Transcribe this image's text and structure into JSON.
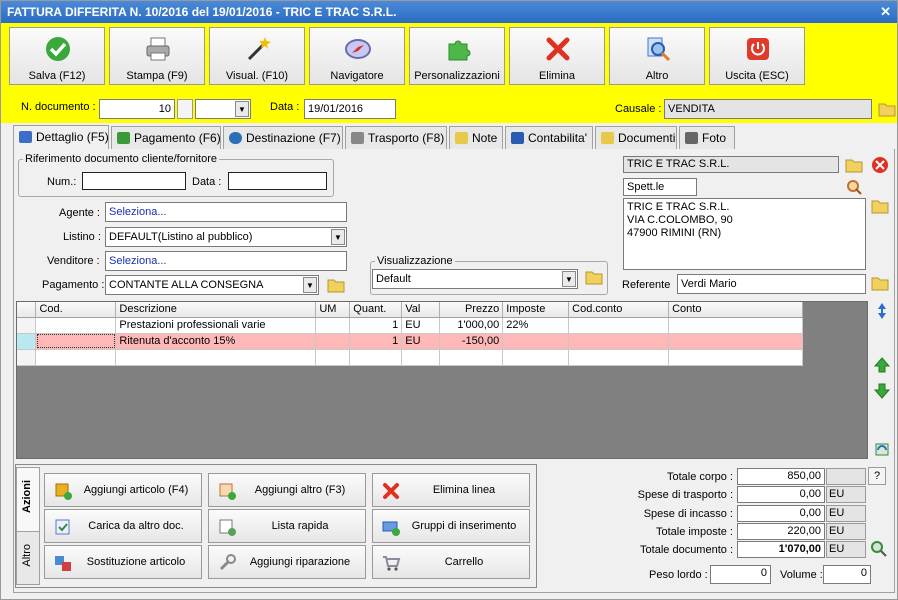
{
  "window": {
    "title": "FATTURA DIFFERITA N. 10/2016 del 19/01/2016 - TRIC E TRAC S.R.L."
  },
  "toolbar": [
    {
      "label": "Salva (F12)",
      "icon": "check-icon",
      "color": "#3aa83a"
    },
    {
      "label": "Stampa (F9)",
      "icon": "printer-icon",
      "color": "#888888"
    },
    {
      "label": "Visual. (F10)",
      "icon": "magic-wand-icon",
      "color": "#333333"
    },
    {
      "label": "Navigatore",
      "icon": "compass-icon",
      "color": "#6a6ab0"
    },
    {
      "label": "Personalizzazioni",
      "icon": "puzzle-icon",
      "color": "#4cb848"
    },
    {
      "label": "Elimina",
      "icon": "red-x-icon",
      "color": "#e03020"
    },
    {
      "label": "Altro",
      "icon": "magnifier-icon",
      "color": "#3a7ad0"
    },
    {
      "label": "Uscita (ESC)",
      "icon": "power-icon",
      "color": "#e03a2a"
    }
  ],
  "header": {
    "ndoc_label": "N. documento :",
    "ndoc_value": "10",
    "data_label": "Data :",
    "data_value": "19/01/2016",
    "causale_label": "Causale :",
    "causale_value": "VENDITA"
  },
  "tabs": [
    {
      "label": "Dettaglio (F5)",
      "icon": "detail-icon",
      "color": "#3a6ec8"
    },
    {
      "label": "Pagamento (F6)",
      "icon": "payment-icon",
      "color": "#3a9a3a"
    },
    {
      "label": "Destinazione (F7)",
      "icon": "globe-icon",
      "color": "#2a70b8"
    },
    {
      "label": "Trasporto (F8)",
      "icon": "truck-icon",
      "color": "#888888"
    },
    {
      "label": "Note",
      "icon": "note-icon",
      "color": "#e8c84a"
    },
    {
      "label": "Contabilita'",
      "icon": "book-icon",
      "color": "#2a5ab0"
    },
    {
      "label": "Documenti",
      "icon": "folder-icon",
      "color": "#e8c84a"
    },
    {
      "label": "Foto",
      "icon": "camera-icon",
      "color": "#666666"
    }
  ],
  "riferimento": {
    "legend": "Riferimento documento cliente/fornitore",
    "num_label": "Num.:",
    "data_label": "Data :",
    "num_value": "",
    "data_value": ""
  },
  "form": {
    "agente_label": "Agente :",
    "agente_value": "Seleziona...",
    "listino_label": "Listino :",
    "listino_value": "DEFAULT(Listino al pubblico)",
    "venditore_label": "Venditore :",
    "venditore_value": "Seleziona...",
    "pagamento_label": "Pagamento :",
    "pagamento_value": "CONTANTE ALLA CONSEGNA"
  },
  "visualizzazione": {
    "legend": "Visualizzazione",
    "value": "Default"
  },
  "cliente": {
    "name": "TRIC E TRAC S.R.L.",
    "salutation": "Spett.le",
    "address": [
      "TRIC E TRAC S.R.L.",
      "VIA C.COLOMBO, 90",
      "47900 RIMINI (RN)"
    ],
    "referente_label": "Referente",
    "referente_value": "Verdi Mario"
  },
  "grid": {
    "columns": [
      "Cod.",
      "Descrizione",
      "UM",
      "Quant.",
      "Val",
      "Prezzo",
      "Imposte",
      "Cod.conto",
      "Conto"
    ],
    "rows": [
      {
        "cod": "",
        "descrizione": "Prestazioni professionali varie",
        "um": "",
        "quant": "1",
        "val": "EU",
        "prezzo": "1'000,00",
        "imposte": "22%",
        "codconto": "",
        "conto": ""
      },
      {
        "cod": "",
        "descrizione": "Ritenuta d'acconto 15%",
        "um": "",
        "quant": "1",
        "val": "EU",
        "prezzo": "-150,00",
        "imposte": "",
        "codconto": "",
        "conto": ""
      }
    ]
  },
  "actions": {
    "vtab_azioni": "Azioni",
    "vtab_altro": "Altro",
    "buttons": [
      {
        "label": "Aggiungi articolo (F4)",
        "icon": "add-article-icon",
        "color": "#e8b020"
      },
      {
        "label": "Aggiungi altro (F3)",
        "icon": "add-other-icon",
        "color": "#e89a40"
      },
      {
        "label": "Elimina linea",
        "icon": "delete-line-icon",
        "color": "#e03020"
      },
      {
        "label": "Carica da altro doc.",
        "icon": "load-doc-icon",
        "color": "#4a80c8"
      },
      {
        "label": "Lista rapida",
        "icon": "quick-list-icon",
        "color": "#5aa05a"
      },
      {
        "label": "Gruppi di inserimento",
        "icon": "groups-icon",
        "color": "#3a6ab8"
      },
      {
        "label": "Sostituzione articolo",
        "icon": "replace-icon",
        "color": "#d04040"
      },
      {
        "label": "Aggiungi riparazione",
        "icon": "wrench-icon",
        "color": "#888888"
      },
      {
        "label": "Carrello",
        "icon": "cart-icon",
        "color": "#8a8aa0"
      }
    ]
  },
  "totals": {
    "totale_corpo_label": "Totale corpo :",
    "totale_corpo": "850,00",
    "spese_trasporto_label": "Spese di trasporto :",
    "spese_trasporto": "0,00",
    "spese_trasporto_cur": "EU",
    "spese_incasso_label": "Spese di incasso :",
    "spese_incasso": "0,00",
    "spese_incasso_cur": "EU",
    "totale_imposte_label": "Totale imposte :",
    "totale_imposte": "220,00",
    "totale_imposte_cur": "EU",
    "totale_documento_label": "Totale documento :",
    "totale_documento": "1'070,00",
    "totale_documento_cur": "EU",
    "help": "?",
    "peso_label": "Peso lordo :",
    "peso_value": "0",
    "volume_label": "Volume :",
    "volume_value": "0"
  }
}
